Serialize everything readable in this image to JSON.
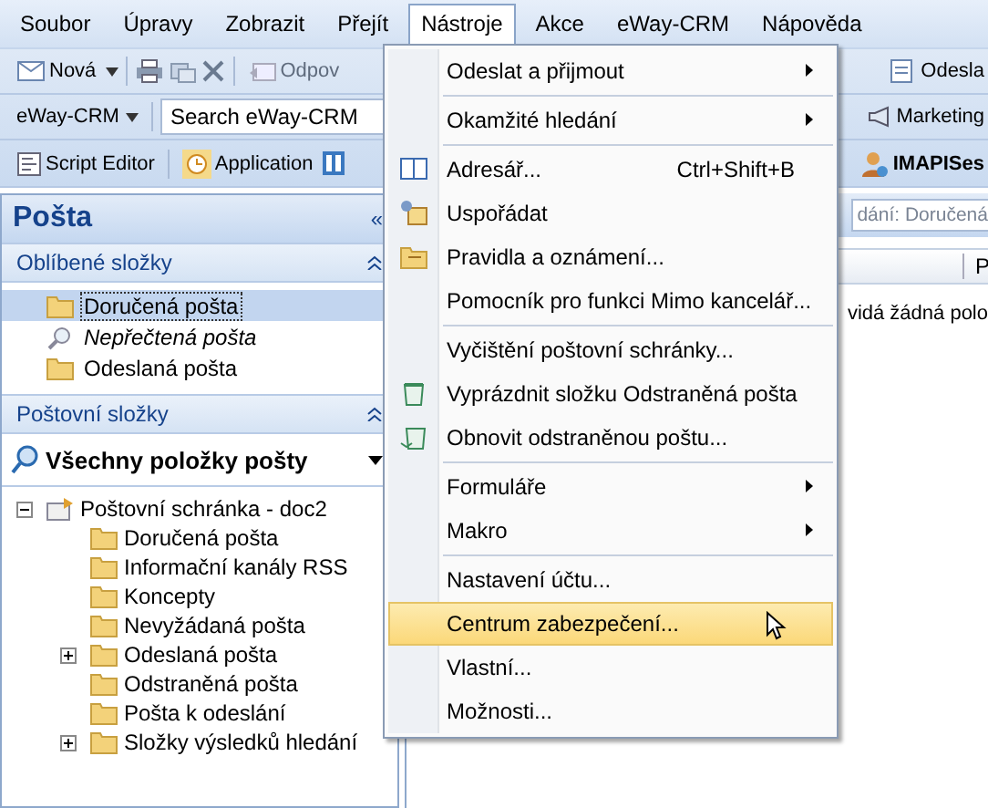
{
  "menu_bar": [
    {
      "label": "Soubor",
      "open": false
    },
    {
      "label": "Úpravy",
      "open": false
    },
    {
      "label": "Zobrazit",
      "open": false
    },
    {
      "label": "Přejít",
      "open": false
    },
    {
      "label": "Nástroje",
      "open": true
    },
    {
      "label": "Akce",
      "open": false
    },
    {
      "label": "eWay-CRM",
      "open": false
    },
    {
      "label": "Nápověda",
      "open": false
    }
  ],
  "toolbar_1": {
    "new_button": "Nová",
    "reply_button": {
      "label": "Odpov",
      "disabled": true
    },
    "right_button": "Odesla"
  },
  "toolbar_2": {
    "crm_dropdown": "eWay-CRM",
    "search": {
      "value": "Search eWay-CRM"
    },
    "right_button": "Marketing"
  },
  "toolbar_3": {
    "buttons": [
      "Script Editor",
      "Application"
    ],
    "right_button": "IMAPISes"
  },
  "nav_pane": {
    "title": "Pošta",
    "collapse": "«",
    "favorites": {
      "title": "Oblíbené složky",
      "items": [
        {
          "label": "Doručená pošta",
          "kind": "folder",
          "selected": true
        },
        {
          "label": "Nepřečtená pošta",
          "kind": "search",
          "selected": false
        },
        {
          "label": "Odeslaná pošta",
          "kind": "folder",
          "selected": false
        }
      ]
    },
    "folders": {
      "title": "Poštovní složky",
      "view": "Všechny položky pošty",
      "tree": [
        {
          "label": "Poštovní schránka - doc2",
          "expanded": true,
          "children": [
            {
              "label": "Doručená pošta"
            },
            {
              "label": "Informační kanály RSS"
            },
            {
              "label": "Koncepty"
            },
            {
              "label": "Nevyžádaná pošta"
            },
            {
              "label": "Odeslaná pošta",
              "expanded": false
            },
            {
              "label": "Odstraněná pošta"
            },
            {
              "label": "Pošta k odeslání"
            },
            {
              "label": "Složky výsledků hledání",
              "expanded": false
            }
          ]
        }
      ]
    }
  },
  "main_pane": {
    "search": {
      "value": "dání: Doručená"
    },
    "column_1": "P",
    "message": "vidá žádná polo"
  },
  "tools_menu": {
    "groups": [
      [
        {
          "label": "Odeslat a přijmout",
          "submenu": true,
          "selected": false
        }
      ],
      [
        {
          "label": "Okamžité hledání",
          "submenu": true,
          "selected": false
        }
      ],
      [
        {
          "label": "Adresář...",
          "shortcut": "Ctrl+Shift+B",
          "selected": false
        },
        {
          "label": "Uspořádat",
          "selected": false
        },
        {
          "label": "Pravidla a oznámení...",
          "selected": false
        },
        {
          "label": "Pomocník pro funkci Mimo kancelář...",
          "selected": false
        }
      ],
      [
        {
          "label": "Vyčištění poštovní schránky...",
          "selected": false
        },
        {
          "label": "Vyprázdnit složku Odstraněná pošta",
          "selected": false
        },
        {
          "label": "Obnovit odstraněnou poštu...",
          "selected": false
        }
      ],
      [
        {
          "label": "Formuláře",
          "submenu": true,
          "selected": false
        },
        {
          "label": "Makro",
          "submenu": true,
          "selected": false
        }
      ],
      [
        {
          "label": "Nastavení účtu...",
          "selected": false
        },
        {
          "label": "Centrum zabezpečení...",
          "selected": true
        },
        {
          "label": "Vlastní...",
          "selected": false
        },
        {
          "label": "Možnosti...",
          "selected": false
        }
      ]
    ]
  }
}
